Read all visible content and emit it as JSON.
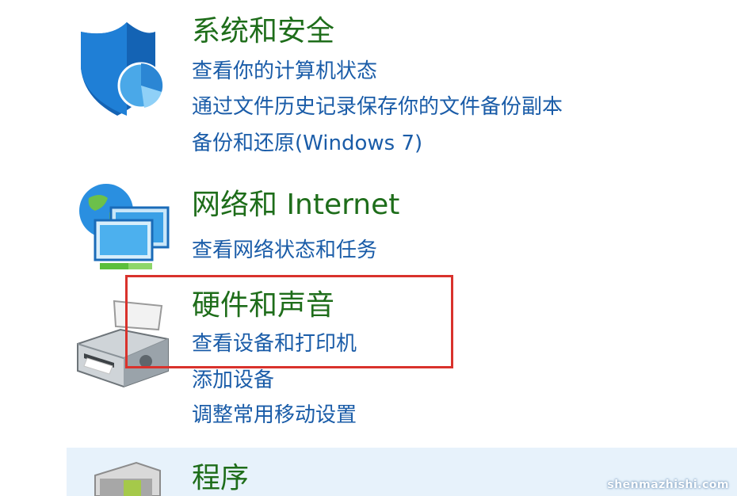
{
  "categories": [
    {
      "title": "系统和安全",
      "icon": "shield-icon",
      "links": [
        "查看你的计算机状态",
        "通过文件历史记录保存你的文件备份副本",
        "备份和还原(Windows 7)"
      ]
    },
    {
      "title": "网络和 Internet",
      "icon": "network-globe-icon",
      "links": [
        "查看网络状态和任务"
      ]
    },
    {
      "title": "硬件和声音",
      "icon": "printer-icon",
      "links": [
        "查看设备和打印机",
        "添加设备",
        "调整常用移动设置"
      ]
    },
    {
      "title": "程序",
      "icon": "programs-icon",
      "links": []
    }
  ],
  "colors": {
    "title_green": "#1e6d1a",
    "link_blue": "#1a5ca8",
    "highlight_red": "#d9322c",
    "hover_band": "#e7f2fb"
  },
  "watermark": "shenmazhishi.com"
}
